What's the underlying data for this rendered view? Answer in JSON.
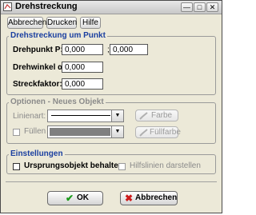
{
  "window": {
    "title": "Drehstreckung",
    "title_icon": "app-icon",
    "controls": [
      "minimize",
      "maximize",
      "close"
    ]
  },
  "toolbar": {
    "cancel_label": "Abbrechen",
    "print_label": "Drucken",
    "help_label": "Hilfe"
  },
  "group_rotation": {
    "title": "Drehstreckung um Punkt",
    "point_label": "Drehpunkt P:",
    "point_x": "0,000",
    "point_sep": ";",
    "point_y": "0,000",
    "angle_label": "Drehwinkel α:",
    "angle_value": "0,000",
    "factor_label": "Streckfaktor:",
    "factor_value": "0,000"
  },
  "group_options": {
    "title": "Optionen - Neues Objekt",
    "line_label": "Linienart:",
    "color_button": "Farbe",
    "fill_label": "Füllen",
    "fill_checked": false,
    "fill_color_button": "Füllfarbe",
    "fill_swatch_color": "#808080"
  },
  "group_settings": {
    "title": "Einstellungen",
    "keep_original_label": "Ursprungsobjekt behalten",
    "keep_original_checked": false,
    "helper_lines_label": "Hilfslinien darstellen",
    "helper_lines_checked": false
  },
  "footer": {
    "ok_label": "OK",
    "cancel_label": "Abbrechen"
  },
  "colors": {
    "group_title": "#1a3fa0",
    "dialog_bg": "#ece9d8",
    "ok_check": "#1a9a1a",
    "cancel_x": "#cc1a1a"
  }
}
